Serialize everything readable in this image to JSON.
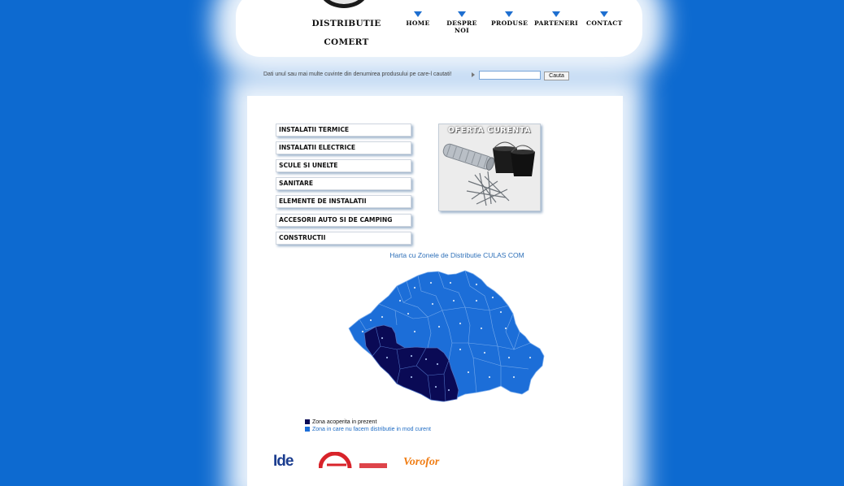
{
  "header": {
    "logo_line1": "DISTRIBUTIE",
    "logo_line2": "COMERT",
    "nav": [
      {
        "label": "HOME"
      },
      {
        "label": "DESPRE NOI"
      },
      {
        "label": "PRODUSE"
      },
      {
        "label": "PARTENERI"
      },
      {
        "label": "CONTACT"
      }
    ]
  },
  "search": {
    "label": "Dati unul sau mai multe cuvinte din denumirea produsului pe care-l cautati!",
    "input_value": "",
    "button_label": "Cauta"
  },
  "categories": [
    {
      "label": "INSTALATII TERMICE"
    },
    {
      "label": "INSTALATII ELECTRICE"
    },
    {
      "label": "SCULE SI UNELTE"
    },
    {
      "label": "SANITARE"
    },
    {
      "label": "ELEMENTE DE INSTALATII"
    },
    {
      "label": "ACCESORII AUTO SI DE CAMPING"
    },
    {
      "label": "CONSTRUCTII"
    }
  ],
  "offer": {
    "title": "OFERTA CURENTA"
  },
  "map": {
    "title": "Harta cu Zonele de Distributie CULAS COM",
    "legend": [
      {
        "label": "Zona acoperita in prezent",
        "color": "#0a0a55"
      },
      {
        "label": "Zona in care nu facem distributie in mod curent",
        "color": "#1c6ed8"
      }
    ]
  },
  "partners": [
    {
      "label": "Ide"
    },
    {
      "label": "Vorofor"
    }
  ],
  "colors": {
    "background": "#0d6ad0",
    "map_uncovered": "#1c6ed8",
    "map_covered": "#0a0a55",
    "nav_marker": "#1e6fd0"
  }
}
